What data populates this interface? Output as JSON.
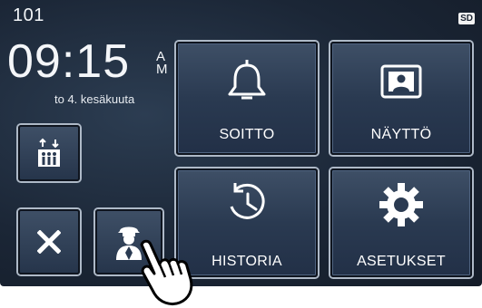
{
  "status": {
    "room_number": "101",
    "sd_badge": "SD",
    "time": "09:15",
    "ampm_top": "A",
    "ampm_bottom": "M",
    "date": "to 4. kesäkuuta"
  },
  "tiles": {
    "call": {
      "label": "SOITTO",
      "icon": "bell-icon"
    },
    "display": {
      "label": "NÄYTTÖ",
      "icon": "monitor-person-icon"
    },
    "history": {
      "label": "HISTORIA",
      "icon": "history-clock-icon"
    },
    "settings": {
      "label": "ASETUKSET",
      "icon": "gear-icon"
    }
  },
  "small_buttons": {
    "elevator": {
      "icon": "elevator-icon"
    },
    "close": {
      "icon": "close-icon"
    },
    "concierge": {
      "icon": "concierge-icon"
    }
  },
  "overlay": {
    "icon": "pointing-hand-icon"
  },
  "colors": {
    "background": "#1b2636",
    "tile_border": "#aeb9c7",
    "text": "#ffffff"
  }
}
